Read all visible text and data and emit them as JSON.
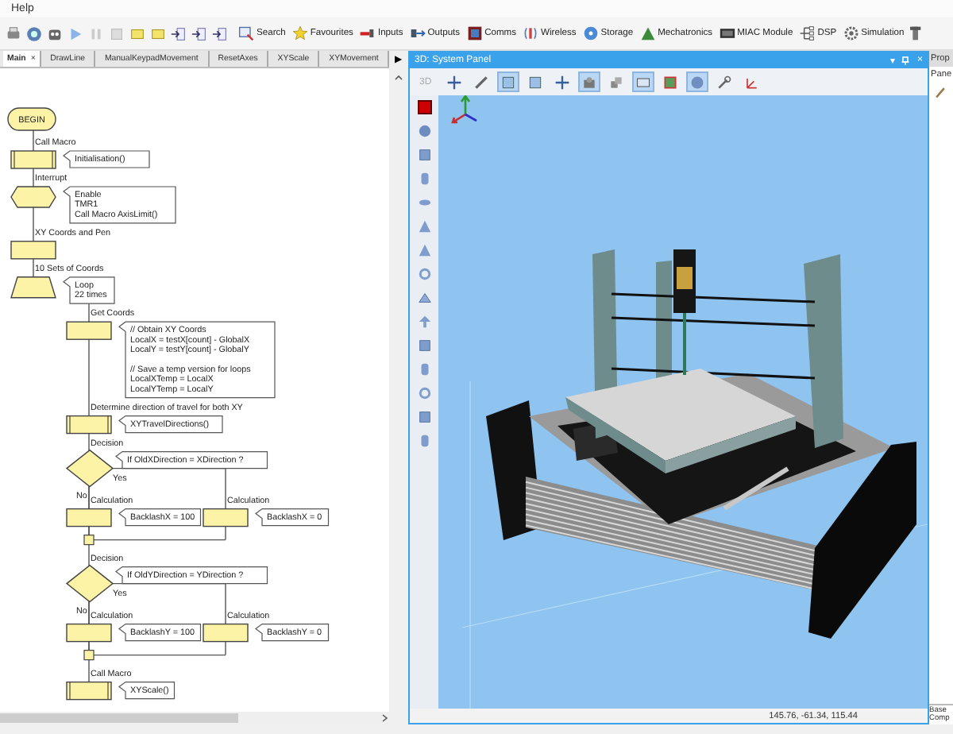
{
  "menu": [
    "Help"
  ],
  "toolbar": {
    "buttons": [
      "Search",
      "Favourites",
      "Inputs",
      "Outputs",
      "Comms",
      "Wireless",
      "Storage",
      "Mechatronics",
      "MIAC Module",
      "DSP",
      "Simulation"
    ]
  },
  "tabs": [
    {
      "label": "Main",
      "selected": true,
      "close": "×"
    },
    {
      "label": "DrawLine",
      "selected": false
    },
    {
      "label": "ManualKeypadMovement",
      "selected": false
    },
    {
      "label": "ResetAxes",
      "selected": false
    },
    {
      "label": "XYScale",
      "selected": false
    },
    {
      "label": "XYMovement",
      "selected": false
    }
  ],
  "tab_scroll": "▶",
  "flowchart": {
    "steps": [
      {
        "kind": "begin",
        "label": "BEGIN"
      },
      {
        "kind": "macro",
        "title": "Call Macro",
        "comment": [
          [
            "Initialisation()"
          ]
        ]
      },
      {
        "kind": "interrupt",
        "title": "Interrupt",
        "comment": [
          [
            "Enable",
            "TMR1",
            "Call Macro AxisLimit()"
          ]
        ]
      },
      {
        "kind": "calc",
        "title": "XY Coords and Pen"
      },
      {
        "kind": "loop",
        "title": "10 Sets of Coords",
        "comment": [
          [
            "Loop",
            "22 times"
          ]
        ],
        "children": [
          {
            "kind": "calc",
            "title": "Get Coords",
            "comment": [
              [
                "// Obtain XY Coords",
                "LocalX = testX[count] - GlobalX",
                "LocalY = testY[count] - GlobalY"
              ],
              [
                "// Save a temp version for loops",
                "LocalXTemp = LocalX",
                "LocalYTemp = LocalY"
              ]
            ]
          },
          {
            "kind": "macro",
            "title": "Determine direction of travel for both XY",
            "comment": [
              [
                "XYTravelDirections()"
              ]
            ]
          },
          {
            "kind": "decision",
            "title": "Decision",
            "comment": [
              [
                "If OldXDirection = XDirection ?"
              ]
            ],
            "yes_label": "Yes",
            "no_label": "No",
            "yes": [
              {
                "kind": "calc",
                "title": "Calculation",
                "comment": [
                  [
                    "BacklashX = 0"
                  ]
                ]
              }
            ],
            "no": [
              {
                "kind": "calc",
                "title": "Calculation",
                "comment": [
                  [
                    "BacklashX = 100"
                  ]
                ]
              }
            ]
          },
          {
            "kind": "decision",
            "title": "Decision",
            "comment": [
              [
                "If OldYDirection = YDirection ?"
              ]
            ],
            "yes_label": "Yes",
            "no_label": "No",
            "yes": [
              {
                "kind": "calc",
                "title": "Calculation",
                "comment": [
                  [
                    "BacklashY = 0"
                  ]
                ]
              }
            ],
            "no": [
              {
                "kind": "calc",
                "title": "Calculation",
                "comment": [
                  [
                    "BacklashY = 100"
                  ]
                ]
              }
            ]
          },
          {
            "kind": "macro",
            "title": "Call Macro",
            "comment": [
              [
                "XYScale()"
              ]
            ]
          }
        ]
      }
    ]
  },
  "panel_3d": {
    "title": "3D: System Panel",
    "title_buttons": [
      "▾",
      "×"
    ],
    "toolbar_label": "3D",
    "view_tools": [
      {
        "selected": false
      },
      {
        "selected": false
      },
      {
        "selected": true
      },
      {
        "selected": false
      },
      {
        "selected": false
      },
      {
        "selected": true
      },
      {
        "selected": false
      },
      {
        "selected": true
      },
      {
        "selected": false
      },
      {
        "selected": true
      },
      {
        "selected": false
      },
      {
        "selected": false
      }
    ],
    "coordinates": "145.76, -61.34, 115.44"
  },
  "properties": {
    "title": "Prop",
    "tab": "Pane",
    "footer": [
      "Base",
      "Comp"
    ]
  }
}
